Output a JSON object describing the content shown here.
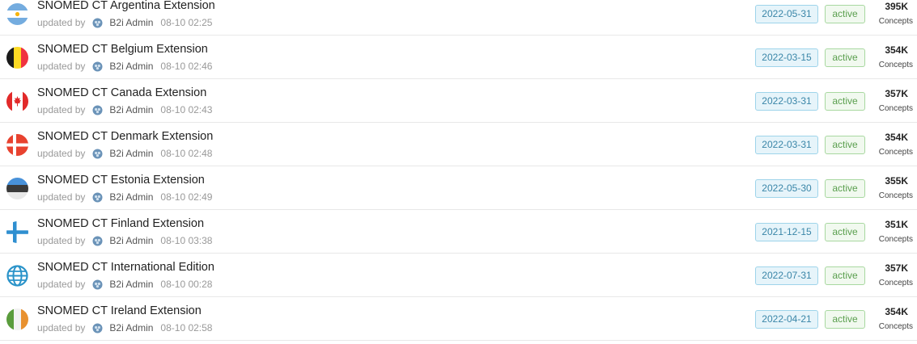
{
  "rows": [
    {
      "name": "SNOMED CT Argentina Extension",
      "flag_icon": "argentina-flag-icon",
      "updated_by_label": "updated by",
      "author": "B2i Admin",
      "time": "08-10 02:25",
      "date": "2022-05-31",
      "status": "active",
      "count": "395K",
      "count_label": "Concepts"
    },
    {
      "name": "SNOMED CT Belgium Extension",
      "flag_icon": "belgium-flag-icon",
      "updated_by_label": "updated by",
      "author": "B2i Admin",
      "time": "08-10 02:46",
      "date": "2022-03-15",
      "status": "active",
      "count": "354K",
      "count_label": "Concepts"
    },
    {
      "name": "SNOMED CT Canada Extension",
      "flag_icon": "canada-flag-icon",
      "updated_by_label": "updated by",
      "author": "B2i Admin",
      "time": "08-10 02:43",
      "date": "2022-03-31",
      "status": "active",
      "count": "357K",
      "count_label": "Concepts"
    },
    {
      "name": "SNOMED CT Denmark Extension",
      "flag_icon": "denmark-flag-icon",
      "updated_by_label": "updated by",
      "author": "B2i Admin",
      "time": "08-10 02:48",
      "date": "2022-03-31",
      "status": "active",
      "count": "354K",
      "count_label": "Concepts"
    },
    {
      "name": "SNOMED CT Estonia Extension",
      "flag_icon": "estonia-flag-icon",
      "updated_by_label": "updated by",
      "author": "B2i Admin",
      "time": "08-10 02:49",
      "date": "2022-05-30",
      "status": "active",
      "count": "355K",
      "count_label": "Concepts"
    },
    {
      "name": "SNOMED CT Finland Extension",
      "flag_icon": "finland-flag-icon",
      "updated_by_label": "updated by",
      "author": "B2i Admin",
      "time": "08-10 03:38",
      "date": "2021-12-15",
      "status": "active",
      "count": "351K",
      "count_label": "Concepts"
    },
    {
      "name": "SNOMED CT International Edition",
      "flag_icon": "globe-icon",
      "updated_by_label": "updated by",
      "author": "B2i Admin",
      "time": "08-10 00:28",
      "date": "2022-07-31",
      "status": "active",
      "count": "357K",
      "count_label": "Concepts"
    },
    {
      "name": "SNOMED CT Ireland Extension",
      "flag_icon": "ireland-flag-icon",
      "updated_by_label": "updated by",
      "author": "B2i Admin",
      "time": "08-10 02:58",
      "date": "2022-04-21",
      "status": "active",
      "count": "354K",
      "count_label": "Concepts"
    }
  ],
  "colors": {
    "date_badge_bg": "#e6f4fa",
    "date_badge_text": "#3a86a8",
    "status_badge_bg": "#f1f9ef",
    "status_badge_text": "#5a9f4e"
  }
}
